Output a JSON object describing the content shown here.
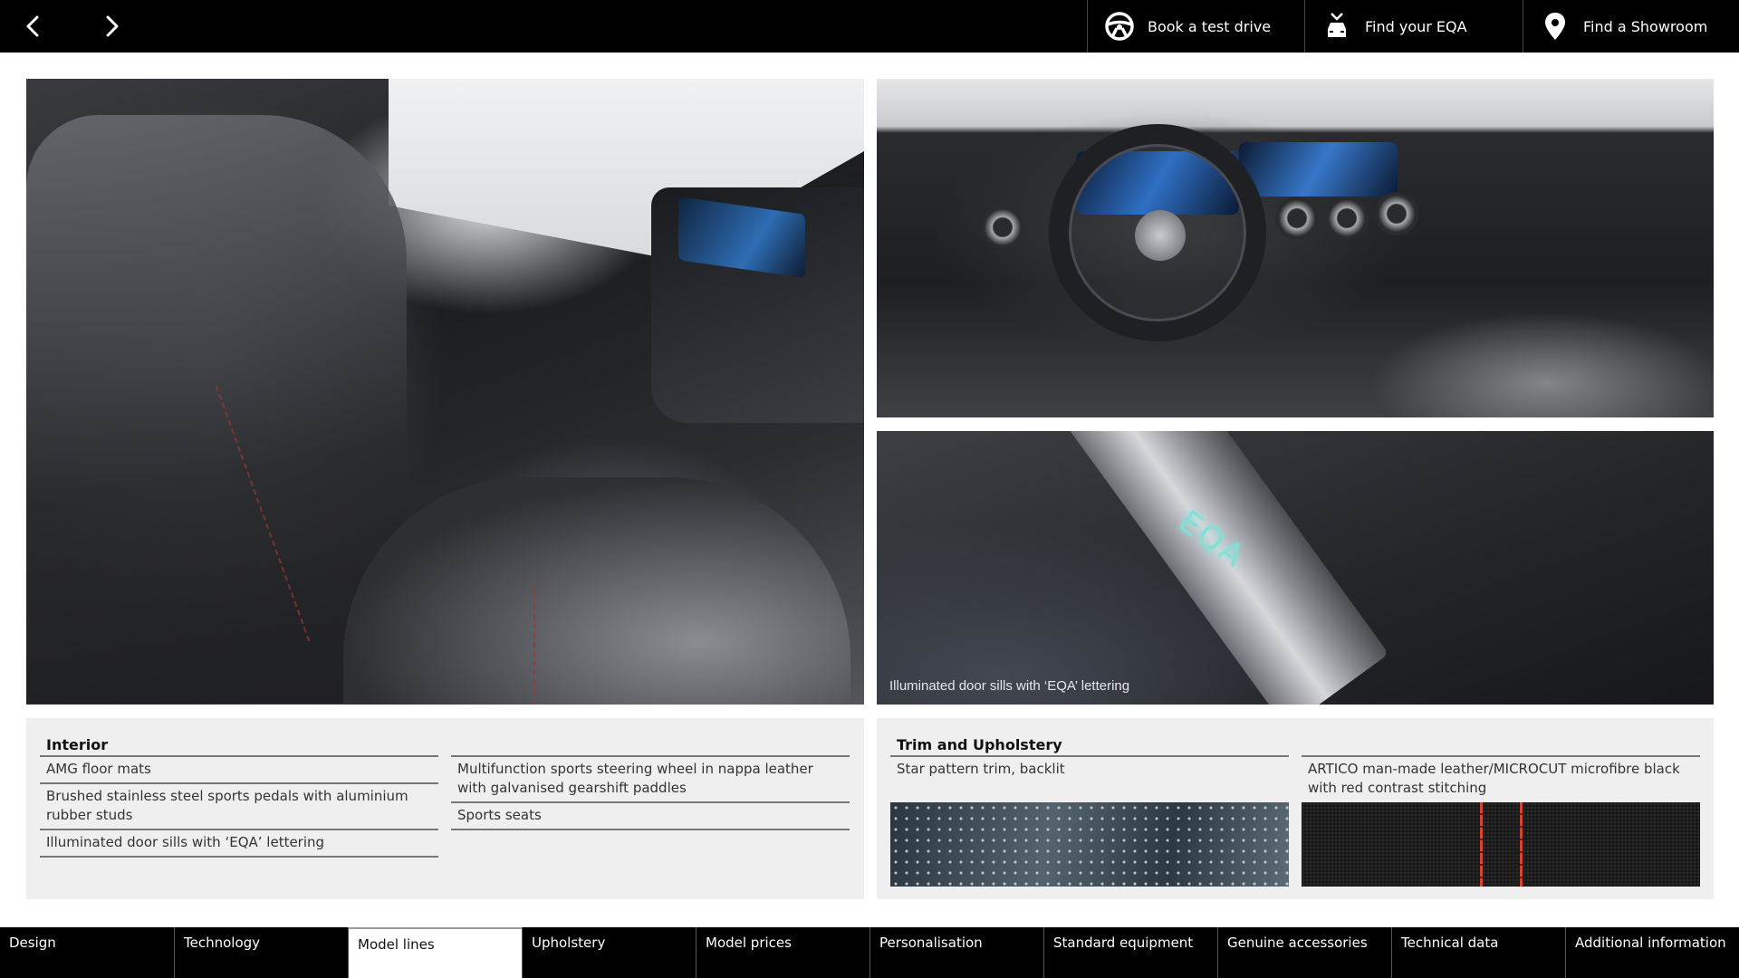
{
  "header": {
    "nav": {
      "prev_icon": "chevron-left-icon",
      "next_icon": "chevron-right-icon"
    },
    "actions": [
      {
        "label": "Book a test drive",
        "icon": "steering-wheel-icon"
      },
      {
        "label": "Find your EQA",
        "icon": "car-search-icon"
      },
      {
        "label": "Find a Showroom",
        "icon": "location-pin-icon"
      }
    ]
  },
  "photos": {
    "door_sill_caption": "Illuminated door sills with ‘EQA’ lettering",
    "sill_lettering": "EQA"
  },
  "interior": {
    "title": "Interior",
    "column1": [
      "AMG floor mats",
      "Brushed stainless steel sports pedals with aluminium rubber studs",
      "Illuminated door sills with ‘EQA’ lettering"
    ],
    "column2": [
      "Multifunction sports steering wheel in nappa leather with galvanised gearshift paddles",
      "Sports seats"
    ]
  },
  "trim": {
    "title": "Trim and Upholstery",
    "options": [
      {
        "label": "Star pattern trim, backlit",
        "swatch": "star-pattern"
      },
      {
        "label": "ARTICO man-made leather/MICROCUT microfibre black with red contrast stitching",
        "swatch": "black-leather-red-stitching"
      }
    ]
  },
  "tabs": {
    "active": "Model lines",
    "items": [
      "Design",
      "Technology",
      "Model lines",
      "Upholstery",
      "Model prices",
      "Personalisation",
      "Standard equipment",
      "Genuine accessories",
      "Technical data",
      "Additional information"
    ]
  },
  "colors": {
    "header_bg": "#000000",
    "panel_bg": "#efefef",
    "active_tab_bg": "#ffffff",
    "stitch_red": "#d8452e",
    "sill_glow": "#7fe0d4"
  }
}
